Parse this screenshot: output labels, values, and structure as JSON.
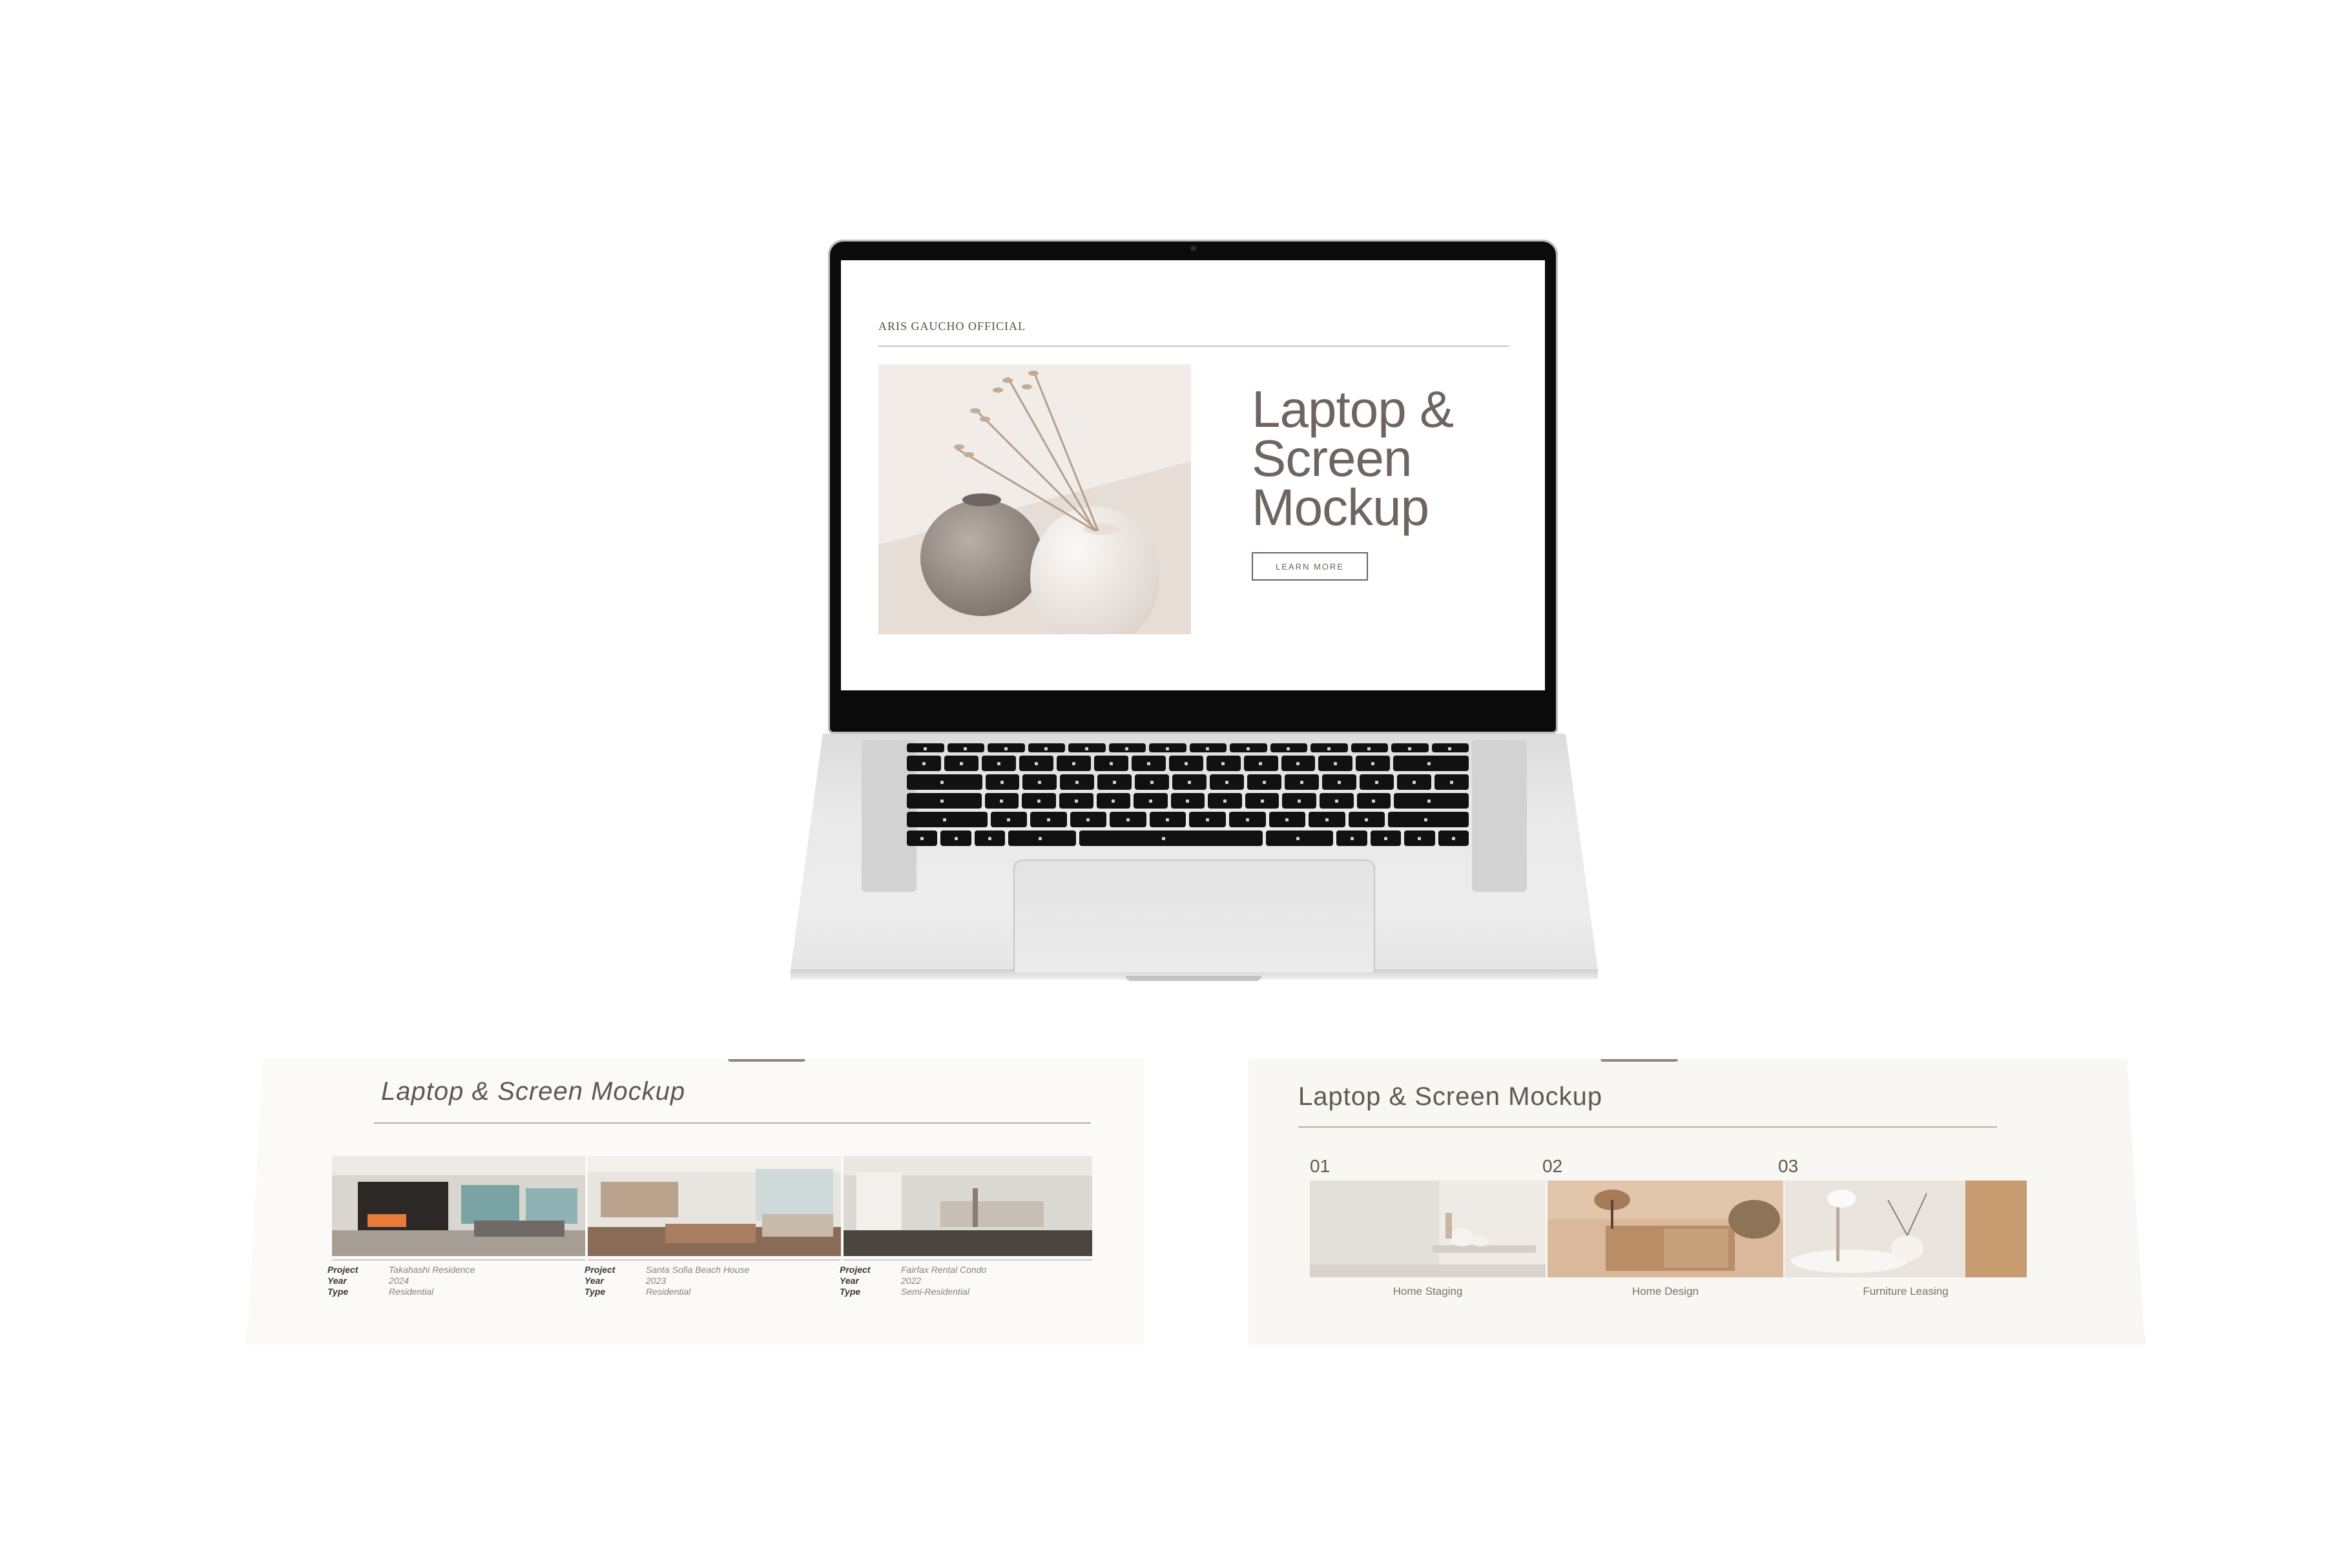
{
  "laptop": {
    "brand": "ARIS GAUCHO OFFICIAL",
    "hero_title": "Laptop & Screen Mockup",
    "hero_title_lines": [
      "Laptop &",
      "Screen",
      "Mockup"
    ],
    "cta_label": "LEARN MORE",
    "hero_image_icon": "vase-with-dried-flowers-photo"
  },
  "projects_screen": {
    "title": "Laptop & Screen Mockup",
    "items": [
      {
        "image": "living-room-fireplace-photo",
        "project_label": "Project",
        "project": "Takahashi Residence",
        "year_label": "Year",
        "year": "2024",
        "type_label": "Type",
        "type": "Residential"
      },
      {
        "image": "bright-living-room-photo",
        "project_label": "Project",
        "project": "Santa Sofia Beach House",
        "year_label": "Year",
        "year": "2023",
        "type_label": "Type",
        "type": "Residential"
      },
      {
        "image": "minimal-living-room-photo",
        "project_label": "Project",
        "project": "Fairfax Rental Condo",
        "year_label": "Year",
        "year": "2022",
        "type_label": "Type",
        "type": "Semi-Residential"
      }
    ]
  },
  "services_screen": {
    "title": "Laptop & Screen Mockup",
    "items": [
      {
        "number": "01",
        "label": "Home Staging",
        "image": "staging-shelf-photo"
      },
      {
        "number": "02",
        "label": "Home Design",
        "image": "wood-cabinet-lamp-photo"
      },
      {
        "number": "03",
        "label": "Furniture Leasing",
        "image": "side-table-lamp-photo"
      }
    ]
  },
  "colors": {
    "accent_text": "#6f6560",
    "panel_edge": "#8f857e",
    "laptop_body": "#e9e9e9",
    "bezel": "#0b0b0b"
  }
}
